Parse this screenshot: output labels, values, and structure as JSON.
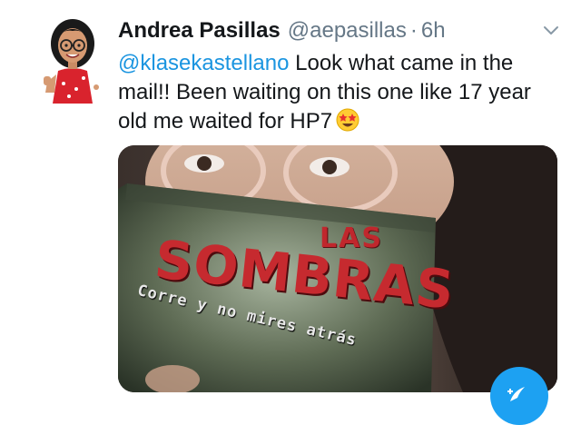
{
  "tweet": {
    "display_name": "Andrea Pasillas",
    "handle": "@aepasillas",
    "separator": "·",
    "time": "6h",
    "mention": "@klasekastellano",
    "body": " Look what came in the mail!! Been waiting on this one like 17 year old me waited for HP7",
    "emoji": "star-struck-emoji"
  },
  "media": {
    "book_title_top": "LAS",
    "book_title_main": "SOMBRAS",
    "book_tagline": "Corre y no mires atrás"
  },
  "icons": {
    "menu": "chevron-down-icon",
    "compose": "compose-tweet-icon"
  },
  "colors": {
    "link": "#1b95e0",
    "secondary_text": "#657786",
    "primary_text": "#14171a",
    "fab": "#1da1f2"
  }
}
